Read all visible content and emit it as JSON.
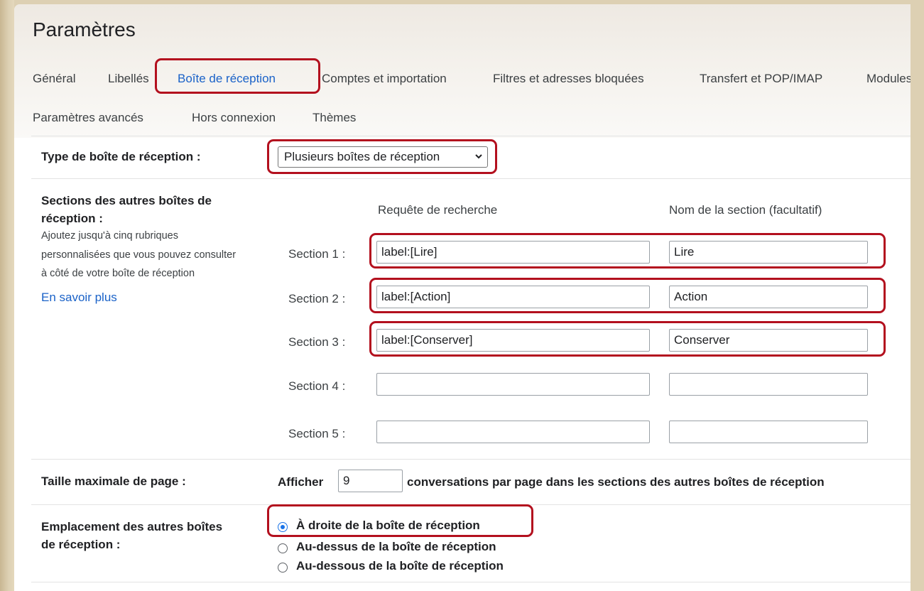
{
  "page": {
    "title": "Paramètres"
  },
  "tabs": [
    {
      "label": "Général"
    },
    {
      "label": "Libellés"
    },
    {
      "label": "Boîte de réception"
    },
    {
      "label": "Comptes et importation"
    },
    {
      "label": "Filtres et adresses bloquées"
    },
    {
      "label": "Transfert et POP/IMAP"
    },
    {
      "label": "Modules"
    },
    {
      "label": "Paramètres avancés"
    },
    {
      "label": "Hors connexion"
    },
    {
      "label": "Thèmes"
    }
  ],
  "active_tab": "Boîte de réception",
  "inbox_type": {
    "label": "Type de boîte de réception :",
    "selected": "Plusieurs boîtes de réception"
  },
  "sections": {
    "title": "Sections des autres boîtes de réception :",
    "description": [
      "Ajoutez jusqu'à cinq rubriques",
      "personnalisées que vous pouvez consulter",
      "à côté de votre boîte de réception"
    ],
    "learn_more": "En savoir plus",
    "col_query": "Requête de recherche",
    "col_name": "Nom de la section (facultatif)",
    "rows": [
      {
        "label": "Section 1 :",
        "query": "label:[Lire]",
        "name": "Lire"
      },
      {
        "label": "Section 2 :",
        "query": "label:[Action]",
        "name": "Action"
      },
      {
        "label": "Section 3 :",
        "query": "label:[Conserver]",
        "name": "Conserver"
      },
      {
        "label": "Section 4 :",
        "query": "",
        "name": ""
      },
      {
        "label": "Section 5 :",
        "query": "",
        "name": ""
      }
    ]
  },
  "page_size": {
    "label": "Taille maximale de page :",
    "prefix": "Afficher",
    "value": "9",
    "suffix": "conversations par page dans les sections des autres boîtes de réception"
  },
  "position": {
    "label_line1": "Emplacement des autres boîtes",
    "label_line2": "de réception :",
    "options": [
      {
        "label": "À droite de la boîte de réception",
        "checked": true
      },
      {
        "label": "Au-dessus de la boîte de réception",
        "checked": false
      },
      {
        "label": "Au-dessous de la boîte de réception",
        "checked": false
      }
    ]
  },
  "colors": {
    "accent": "#1a62c8",
    "highlight": "#b3101e",
    "radio": "#1a73e8"
  }
}
